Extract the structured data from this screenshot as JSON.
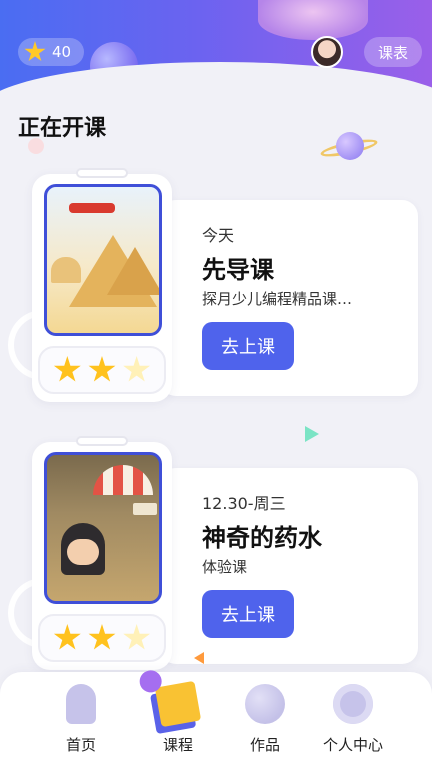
{
  "header": {
    "star_count": "40",
    "schedule_label": "课表"
  },
  "section_title": "正在开课",
  "courses": [
    {
      "date": "今天",
      "title": "先导课",
      "subtitle": "探月少儿编程精品课…",
      "button": "去上课",
      "stars_earned": 2,
      "stars_total": 3
    },
    {
      "date": "12.30-周三",
      "title": "神奇的药水",
      "subtitle": "体验课",
      "button": "去上课",
      "stars_earned": 2,
      "stars_total": 3
    }
  ],
  "nav": {
    "items": [
      {
        "label": "首页",
        "icon": "rocket-icon"
      },
      {
        "label": "课程",
        "icon": "course-icon"
      },
      {
        "label": "作品",
        "icon": "planet-icon"
      },
      {
        "label": "个人中心",
        "icon": "astronaut-icon"
      }
    ]
  },
  "colors": {
    "accent": "#4f63ec",
    "star": "#ffc21e"
  }
}
